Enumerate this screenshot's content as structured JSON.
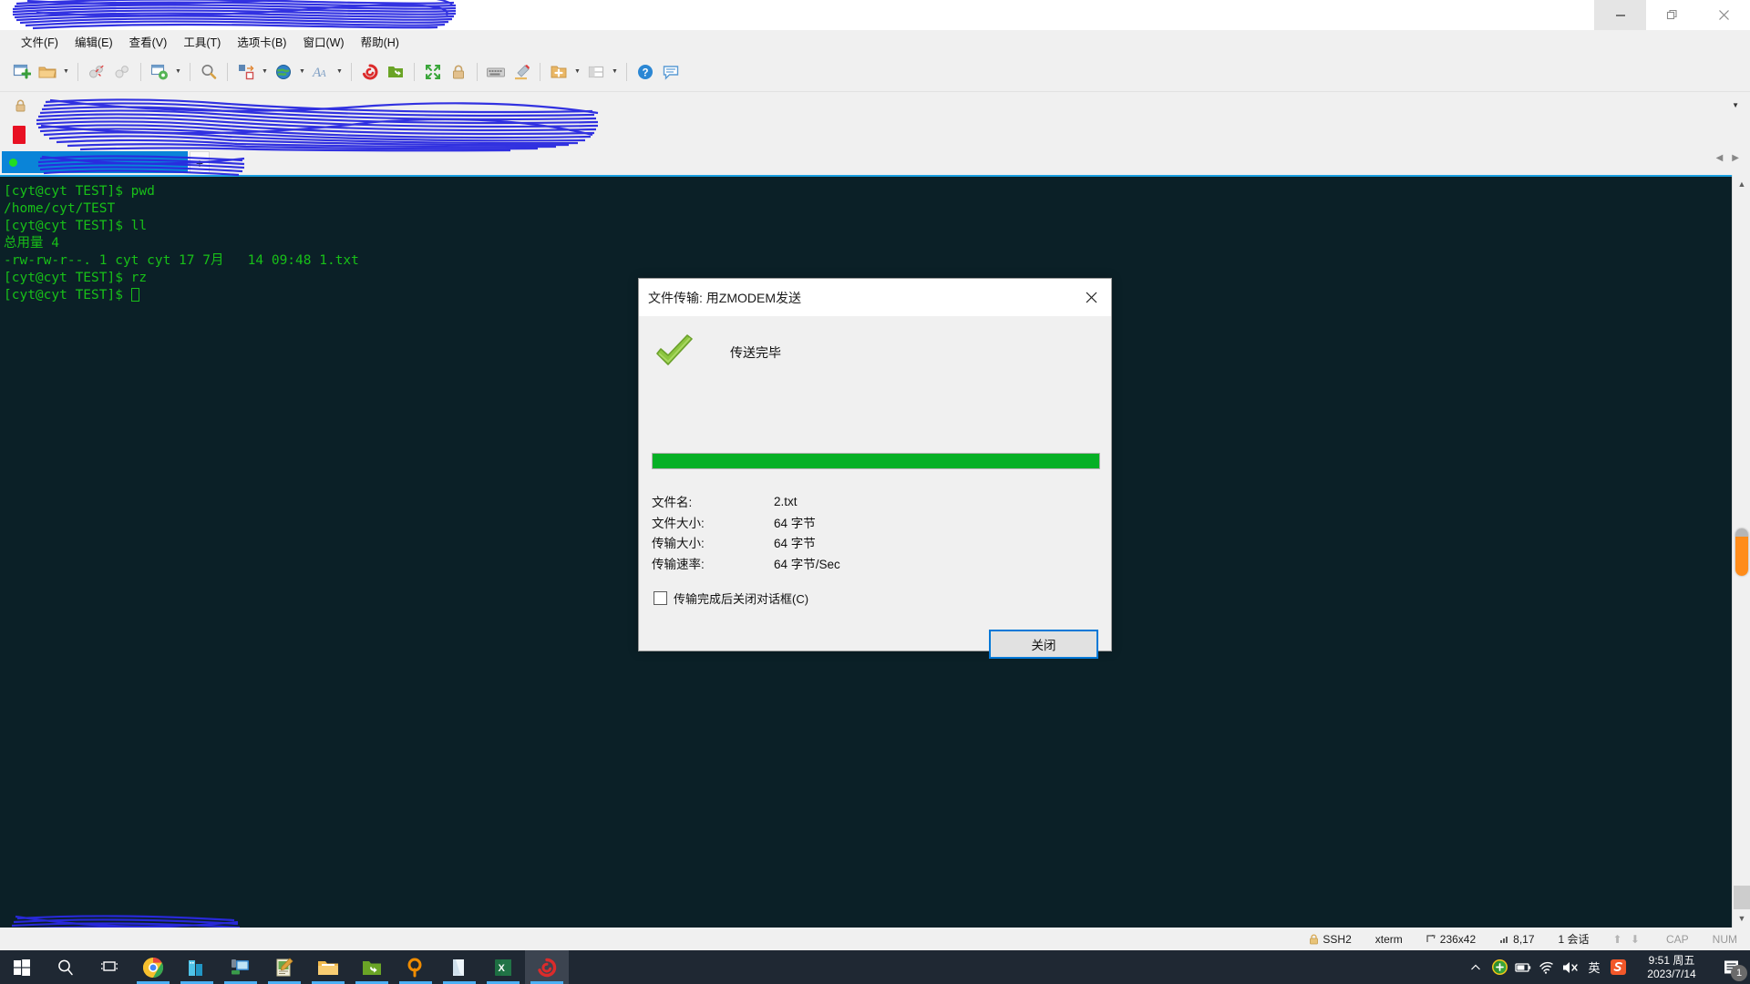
{
  "window": {
    "title": "",
    "controls": [
      {
        "name": "minimize",
        "glyph": "minimize-icon"
      },
      {
        "name": "restore",
        "glyph": "restore-icon"
      },
      {
        "name": "close",
        "glyph": "close-icon"
      }
    ]
  },
  "menubar": {
    "items": [
      {
        "label": "文件(F)"
      },
      {
        "label": "编辑(E)"
      },
      {
        "label": "查看(V)"
      },
      {
        "label": "工具(T)"
      },
      {
        "label": "选项卡(B)"
      },
      {
        "label": "窗口(W)"
      },
      {
        "label": "帮助(H)"
      }
    ]
  },
  "toolbar": {
    "icons": [
      "new-session-icon",
      "open-folder-icon",
      "disconnect-icon",
      "connect-link-icon",
      "session-options-icon",
      "find-icon",
      "transfer-icon",
      "globe-icon",
      "font-icon",
      "xshell-icon",
      "xftp-icon",
      "fullscreen-icon",
      "lock-icon",
      "keyboard-icon",
      "highlight-icon",
      "new-folder-icon",
      "layout-icon",
      "help-icon",
      "comment-icon"
    ]
  },
  "session_strip": {
    "lock_icon": "lock-icon",
    "address": "",
    "caret": "chevron-down-icon"
  },
  "tabbar": {
    "active_tab_label": "",
    "new_tab_label": "+"
  },
  "terminal": {
    "lines": [
      "[cyt@cyt TEST]$ pwd",
      "/home/cyt/TEST",
      "[cyt@cyt TEST]$ ll",
      "总用量 4",
      "-rw-rw-r--. 1 cyt cyt 17 7月   14 09:48 1.txt",
      "[cyt@cyt TEST]$ rz",
      "",
      "[cyt@cyt TEST]$ "
    ],
    "foreground_color": "#18c018",
    "background_color": "#0b2027"
  },
  "statusbar": {
    "protocol": "SSH2",
    "terminal_type": "xterm",
    "size_icon": "terminal-size-icon",
    "size": "236x42",
    "cursor_icon": "cursor-pos-icon",
    "cursor": "8,17",
    "sessions": "1 会话",
    "updown": "⬆ ⬇",
    "cap": "CAP",
    "num": "NUM"
  },
  "dialog": {
    "title": "文件传输: 用ZMODEM发送",
    "close_icon": "close-icon",
    "status_icon": "green-check-icon",
    "status_text": "传送完毕",
    "progress_percent": 100,
    "progress_color": "#06b025",
    "fields": [
      {
        "label": "文件名:",
        "value": "2.txt"
      },
      {
        "label": "文件大小:",
        "value": "64 字节"
      },
      {
        "label": "传输大小:",
        "value": "64 字节"
      },
      {
        "label": "传输速率:",
        "value": "64 字节/Sec"
      }
    ],
    "checkbox_label": "传输完成后关闭对话框(C)",
    "checkbox_checked": false,
    "button_label": "关闭",
    "button_focus_color": "#0078d7"
  },
  "taskbar": {
    "start_icon": "windows-start-icon",
    "search_icon": "search-icon",
    "taskview_icon": "task-view-icon",
    "apps": [
      {
        "name": "chrome-icon",
        "running": true,
        "active": false
      },
      {
        "name": "app-blue-icon",
        "running": true,
        "active": false
      },
      {
        "name": "remote-desktop-icon",
        "running": true,
        "active": false
      },
      {
        "name": "editor-icon",
        "running": true,
        "active": false
      },
      {
        "name": "file-explorer-icon",
        "running": true,
        "active": false
      },
      {
        "name": "xftp-icon",
        "running": true,
        "active": false
      },
      {
        "name": "everything-search-icon",
        "running": true,
        "active": false
      },
      {
        "name": "notepad-icon",
        "running": true,
        "active": false
      },
      {
        "name": "excel-icon",
        "running": true,
        "active": false
      },
      {
        "name": "xshell-icon",
        "running": true,
        "active": true
      }
    ],
    "tray": {
      "expand_icon": "chevron-up-icon",
      "icons": [
        "shield-green-icon",
        "battery-icon",
        "wifi-icon",
        "volume-muted-icon"
      ],
      "ime_label": "英",
      "ime_app_icon": "sogou-icon",
      "clock_time": "9:51 周五",
      "clock_date": "2023/7/14",
      "notification_icon": "notification-icon",
      "notification_count": "1"
    }
  }
}
